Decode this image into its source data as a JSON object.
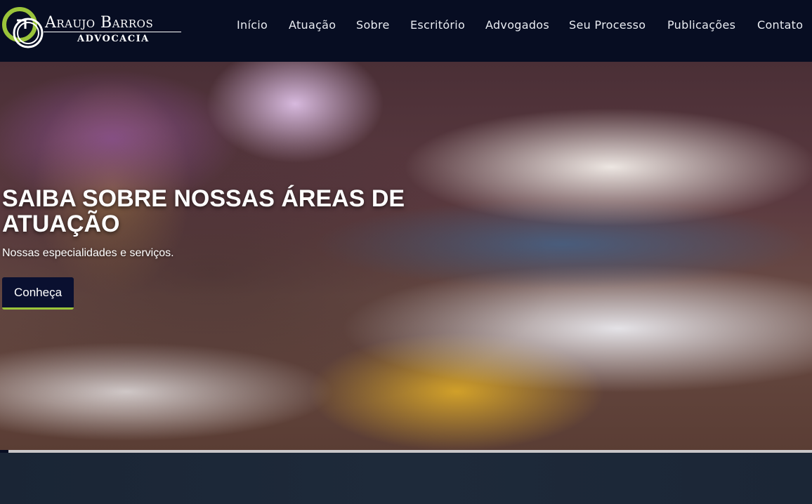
{
  "logo": {
    "name": "Araujo Barros",
    "subtitle": "ADVOCACIA"
  },
  "nav": {
    "items": [
      {
        "label": "Início"
      },
      {
        "label": "Atuação"
      },
      {
        "label": "Sobre"
      },
      {
        "label": "Escritório"
      },
      {
        "label": "Advogados"
      },
      {
        "label": "Seu Processo"
      },
      {
        "label": "Publicações"
      },
      {
        "label": "Contato"
      }
    ]
  },
  "hero": {
    "title": "SAIBA SOBRE NOSSAS ÁREAS DE ATUAÇÃO",
    "subtitle": "Nossas especialidades e serviços.",
    "cta_label": "Conheça"
  },
  "colors": {
    "header_bg": "#070d22",
    "accent": "#9ac43a",
    "button_bg": "#0a1030"
  }
}
